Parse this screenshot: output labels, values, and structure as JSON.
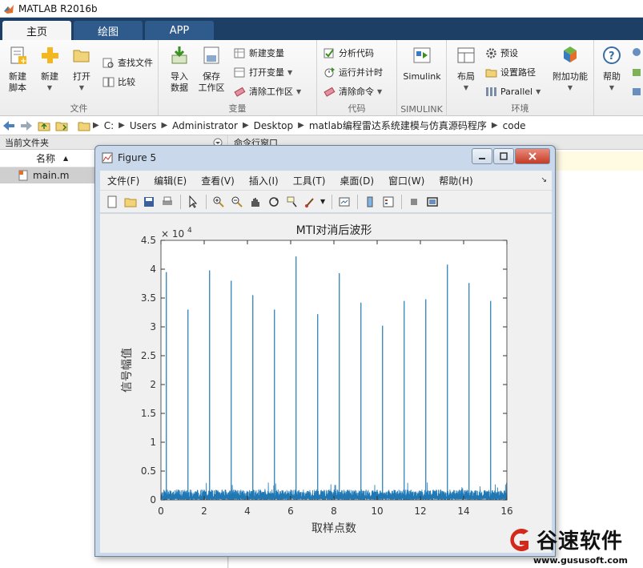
{
  "app": {
    "title": "MATLAB R2016b"
  },
  "tabs": [
    {
      "label": "主页",
      "active": true
    },
    {
      "label": "绘图",
      "active": false
    },
    {
      "label": "APP",
      "active": false
    }
  ],
  "ribbon": {
    "file": {
      "group": "文件",
      "new_script": "新建\n脚本",
      "new": "新建",
      "open": "打开",
      "find_files": "查找文件",
      "compare": "比较"
    },
    "variable": {
      "group": "变量",
      "import": "导入\n数据",
      "save_ws": "保存\n工作区",
      "new_var": "新建变量",
      "open_var": "打开变量",
      "clear_ws": "清除工作区"
    },
    "code": {
      "group": "代码",
      "analyze": "分析代码",
      "run_time": "运行并计时",
      "clear_cmd": "清除命令"
    },
    "simulink": {
      "group": "SIMULINK",
      "label": "Simulink"
    },
    "env": {
      "group": "环境",
      "layout": "布局",
      "prefs": "预设",
      "set_path": "设置路径",
      "parallel": "Parallel",
      "addons": "附加功能"
    },
    "resources": {
      "help": "帮助"
    }
  },
  "address": {
    "crumbs": [
      "C:",
      "Users",
      "Administrator",
      "Desktop",
      "matlab编程雷达系统建模与仿真源码程序",
      "code"
    ]
  },
  "left_panel": {
    "title": "当前文件夹",
    "col_name": "名称",
    "file": "main.m"
  },
  "right_panel": {
    "title": "命令行窗口"
  },
  "figure": {
    "title": "Figure 5",
    "menu": [
      "文件(F)",
      "编辑(E)",
      "查看(V)",
      "插入(I)",
      "工具(T)",
      "桌面(D)",
      "窗口(W)",
      "帮助(H)"
    ]
  },
  "colors": {
    "line": "#1f77b4",
    "tabstrip": "#1d3f66"
  },
  "chart_data": {
    "type": "line",
    "title": "MTI对消后波形",
    "xlabel": "取样点数",
    "ylabel": "信号幅值",
    "xlim": [
      0,
      16
    ],
    "ylim": [
      0,
      45000
    ],
    "x_ticks": [
      "0",
      "2",
      "4",
      "6",
      "8",
      "10",
      "12",
      "14",
      "16"
    ],
    "y_ticks": [
      "0",
      "0.5",
      "1",
      "1.5",
      "2",
      "2.5",
      "3",
      "3.5",
      "4",
      "4.5"
    ],
    "y_exponent": "× 10",
    "y_exponent_power": "4",
    "noise_level": 1800,
    "peaks": [
      {
        "x": 0.25,
        "y": 39500
      },
      {
        "x": 1.25,
        "y": 33000
      },
      {
        "x": 2.25,
        "y": 39800
      },
      {
        "x": 3.25,
        "y": 38000
      },
      {
        "x": 4.25,
        "y": 35500
      },
      {
        "x": 5.25,
        "y": 33000
      },
      {
        "x": 6.25,
        "y": 42200
      },
      {
        "x": 7.25,
        "y": 32200
      },
      {
        "x": 8.25,
        "y": 39300
      },
      {
        "x": 9.25,
        "y": 34200
      },
      {
        "x": 10.25,
        "y": 30200
      },
      {
        "x": 11.25,
        "y": 34500
      },
      {
        "x": 12.25,
        "y": 34800
      },
      {
        "x": 13.25,
        "y": 40800
      },
      {
        "x": 14.25,
        "y": 37600
      },
      {
        "x": 15.25,
        "y": 34500
      }
    ]
  },
  "watermark": {
    "brand": "谷速软件",
    "url": "www.gususoft.com"
  }
}
